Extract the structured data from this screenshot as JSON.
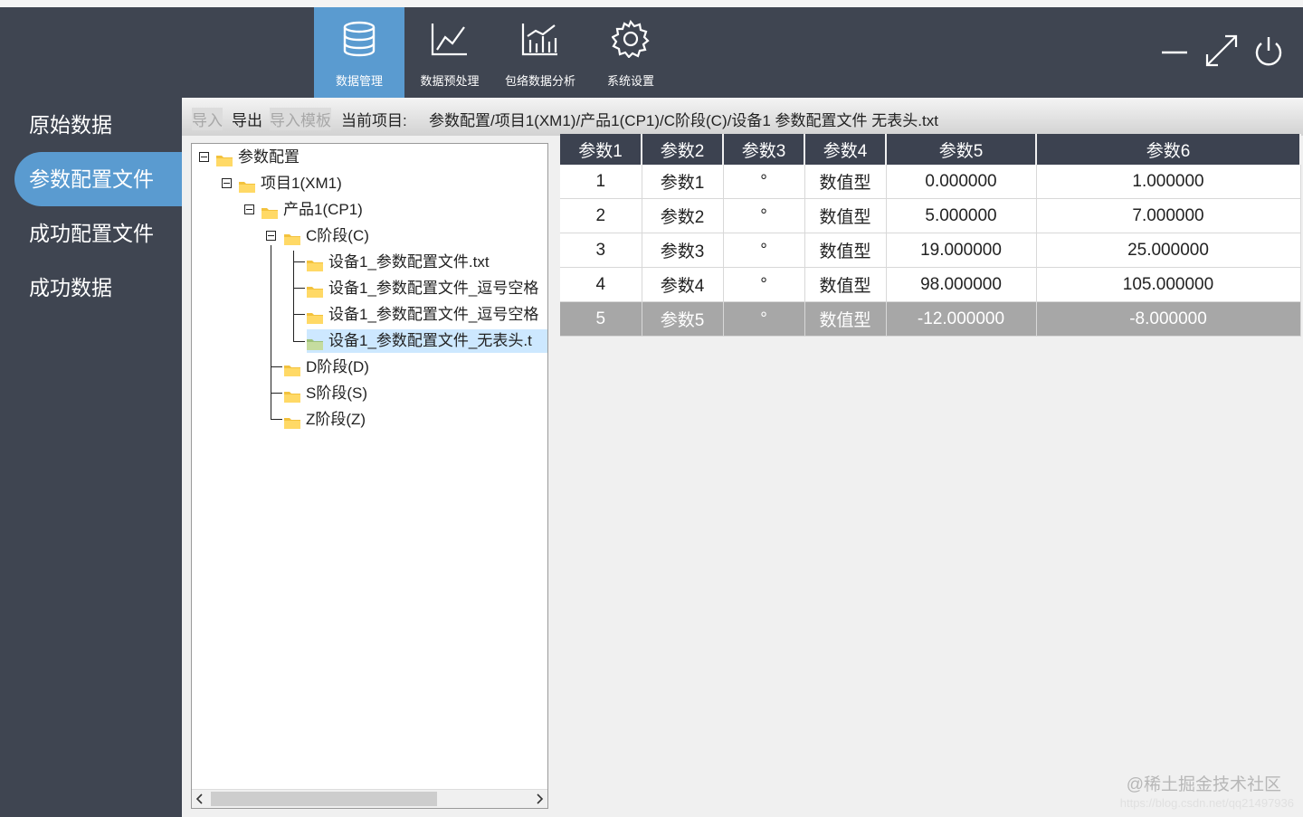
{
  "nav": {
    "items": [
      {
        "label": "数据管理",
        "icon": "database-icon",
        "active": true
      },
      {
        "label": "数据预处理",
        "icon": "line-chart-icon",
        "active": false
      },
      {
        "label": "包络数据分析",
        "icon": "bar-chart-icon",
        "active": false
      },
      {
        "label": "系统设置",
        "icon": "gear-icon",
        "active": false
      }
    ]
  },
  "window_controls": [
    "minimize-icon",
    "maximize-icon",
    "power-icon"
  ],
  "sidebar": {
    "items": [
      {
        "label": "原始数据",
        "active": false
      },
      {
        "label": "参数配置文件",
        "active": true
      },
      {
        "label": "成功配置文件",
        "active": false
      },
      {
        "label": "成功数据",
        "active": false
      }
    ]
  },
  "toolbar": {
    "import_label": "导入",
    "export_label": "导出",
    "import_template_label": "导入模板",
    "current_project_label": "当前项目:",
    "current_path": "参数配置/项目1(XM1)/产品1(CP1)/C阶段(C)/设备1  参数配置文件  无表头.txt"
  },
  "tree": {
    "nodes": [
      {
        "label": "参数配置"
      },
      {
        "label": "项目1(XM1)"
      },
      {
        "label": "产品1(CP1)"
      },
      {
        "label": "C阶段(C)"
      },
      {
        "label": "设备1_参数配置文件.txt"
      },
      {
        "label": "设备1_参数配置文件_逗号空格"
      },
      {
        "label": "设备1_参数配置文件_逗号空格"
      },
      {
        "label": "设备1_参数配置文件_无表头.t",
        "selected": true
      },
      {
        "label": "D阶段(D)"
      },
      {
        "label": "S阶段(S)"
      },
      {
        "label": "Z阶段(Z)"
      }
    ]
  },
  "table": {
    "columns": [
      "参数1",
      "参数2",
      "参数3",
      "参数4",
      "参数5",
      "参数6"
    ],
    "rows": [
      [
        "1",
        "参数1",
        "°",
        "数值型",
        "0.000000",
        "1.000000"
      ],
      [
        "2",
        "参数2",
        "°",
        "数值型",
        "5.000000",
        "7.000000"
      ],
      [
        "3",
        "参数3",
        "°",
        "数值型",
        "19.000000",
        "25.000000"
      ],
      [
        "4",
        "参数4",
        "°",
        "数值型",
        "98.000000",
        "105.000000"
      ],
      [
        "5",
        "参数5",
        "°",
        "数值型",
        "-12.000000",
        "-8.000000"
      ]
    ],
    "selected_row": 5
  },
  "watermark": {
    "main": "@稀土掘金技术社区",
    "sub": "https://blog.csdn.net/qq21497936"
  },
  "colors": {
    "chrome_dark": "#3f4551",
    "accent": "#5a9bd0",
    "selected_row": "#a7a7a7"
  }
}
